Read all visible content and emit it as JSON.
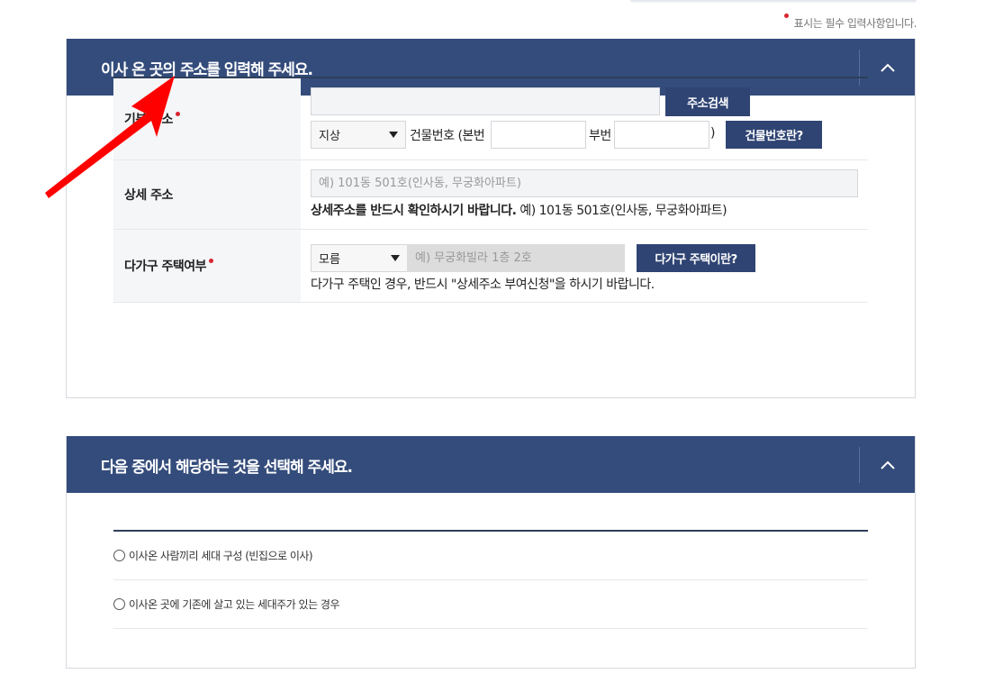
{
  "required_note": "표시는 필수 입력사항입니다.",
  "address_panel": {
    "title": "이사 온 곳의 주소를 입력해 주세요.",
    "toggle_icon": "chevron-up-icon",
    "basic_address": {
      "label": "기본 주소",
      "address_value": "",
      "search_button": "주소검색",
      "land_type_selected": "지상",
      "building_no_prefix": "건물번호 (본번",
      "main_no_value": "",
      "sub_label": "부번",
      "sub_no_value": "",
      "building_no_suffix": ")",
      "help_button": "건물번호란?"
    },
    "detail_address": {
      "label": "상세 주소",
      "placeholder": "예) 101동 501호(인사동, 무궁화아파트)",
      "hint_bold": "상세주소를 반드시 확인하시기 바랍니다.",
      "hint_normal": " 예) 101동 501호(인사동, 무궁화아파트)"
    },
    "multi_household": {
      "label": "다가구 주택여부",
      "selected": "모름",
      "placeholder": "예) 무궁화빌라 1층 2호",
      "help_button": "다가구 주택이란?",
      "hint": "다가구 주택인 경우, 반드시 \"상세주소 부여신청\"을 하시기 바랍니다."
    }
  },
  "choice_panel": {
    "title": "다음 중에서 해당하는 것을 선택해 주세요.",
    "toggle_icon": "chevron-up-icon",
    "options": [
      "이사온 사람끼리 세대 구성 (빈집으로 이사)",
      "이사온 곳에 기존에 살고 있는 세대주가 있는 경우"
    ]
  },
  "colors": {
    "header": "#344c7b",
    "button": "#2f4473",
    "required_dot": "#d7262e",
    "annotation_arrow": "#ff0000"
  }
}
